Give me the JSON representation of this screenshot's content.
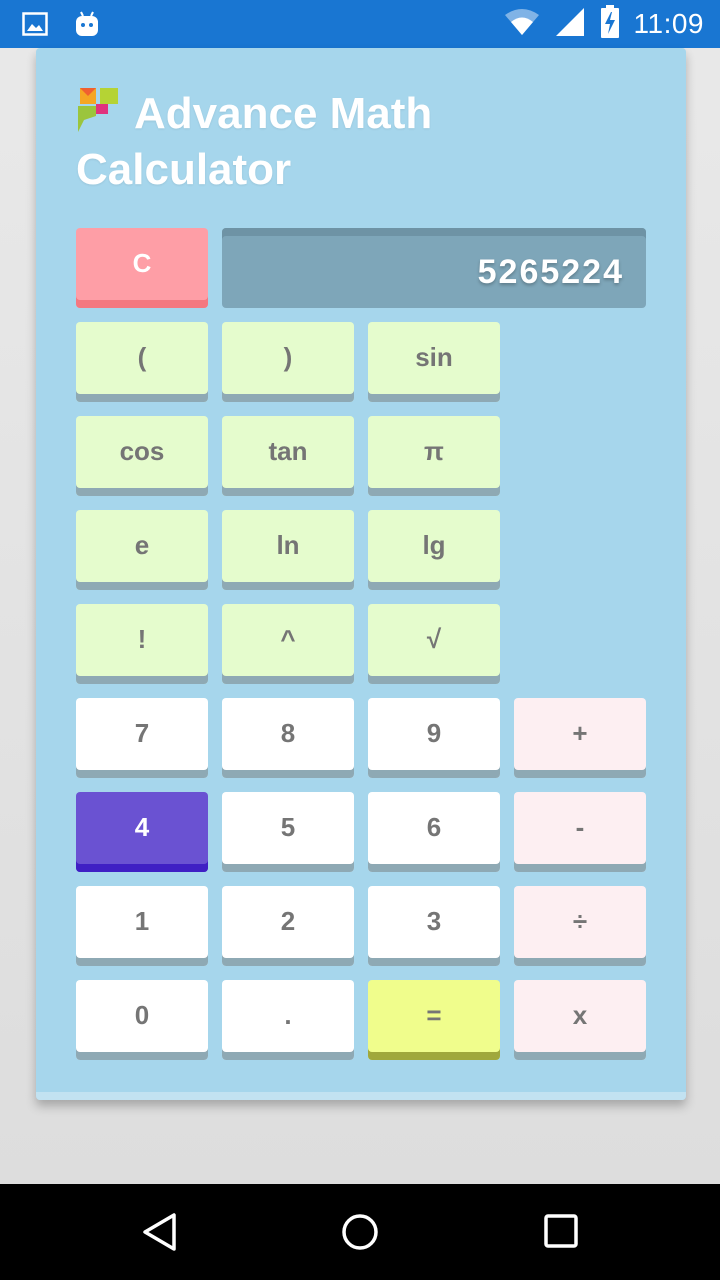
{
  "status_bar": {
    "time": "11:09",
    "icons": [
      "image-icon",
      "android-icon",
      "wifi-icon",
      "signal-icon",
      "battery-charging-icon"
    ]
  },
  "app": {
    "title": "Advance Math Calculator",
    "logo": "app-logo-icon"
  },
  "display": {
    "value": "5265224"
  },
  "buttons": {
    "clear": "C",
    "lparen": "(",
    "rparen": ")",
    "sin": "sin",
    "cos": "cos",
    "tan": "tan",
    "pi": "π",
    "e": "e",
    "ln": "ln",
    "lg": "lg",
    "fact": "!",
    "pow": "^",
    "sqrt": "√",
    "d7": "7",
    "d8": "8",
    "d9": "9",
    "plus": "+",
    "d4": "4",
    "d5": "5",
    "d6": "6",
    "minus": "-",
    "d1": "1",
    "d2": "2",
    "d3": "3",
    "divide": "÷",
    "d0": "0",
    "dot": ".",
    "equals": "=",
    "multiply": "x"
  },
  "pressed_button": "4",
  "colors": {
    "status_bar": "#1976d2",
    "card": "#a6d6ec",
    "scientific_key": "#e5fccd",
    "digit_key": "#ffffff",
    "operator_key": "#fdeff2",
    "equals_key": "#f0fd8c",
    "clear_key": "#fe9ea6",
    "pressed_key": "#6a52d2",
    "display": "#7ea6b9"
  },
  "nav_bar": {
    "icons": [
      "back-icon",
      "home-icon",
      "recents-icon"
    ]
  }
}
